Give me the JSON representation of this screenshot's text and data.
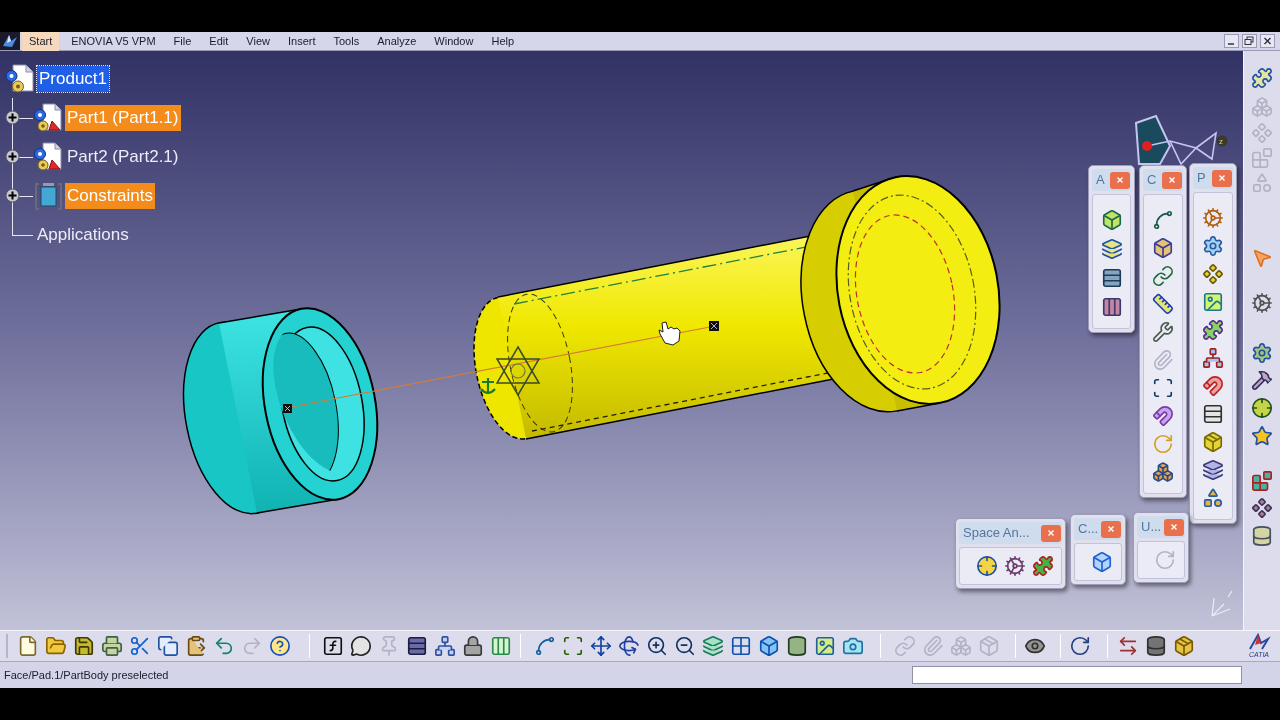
{
  "menu_bar": {
    "items": [
      {
        "label": "Start",
        "selected": true
      },
      {
        "label": "ENOVIA V5 VPM",
        "selected": false
      },
      {
        "label": "File",
        "selected": false
      },
      {
        "label": "Edit",
        "selected": false
      },
      {
        "label": "View",
        "selected": false
      },
      {
        "label": "Insert",
        "selected": false
      },
      {
        "label": "Tools",
        "selected": false
      },
      {
        "label": "Analyze",
        "selected": false
      },
      {
        "label": "Window",
        "selected": false
      },
      {
        "label": "Help",
        "selected": false
      }
    ]
  },
  "tree": [
    {
      "label": "Product1",
      "kind": "product",
      "selected": true,
      "highlighted": false,
      "expandable": false,
      "children": [
        {
          "label": "Part1 (Part1.1)",
          "kind": "part",
          "selected": false,
          "highlighted": true,
          "expandable": true
        },
        {
          "label": "Part2 (Part2.1)",
          "kind": "part",
          "selected": false,
          "highlighted": false,
          "expandable": true
        },
        {
          "label": "Constraints",
          "kind": "constraints",
          "selected": false,
          "highlighted": true,
          "expandable": true
        },
        {
          "label": "Applications",
          "kind": "label",
          "selected": false,
          "highlighted": false,
          "expandable": false
        }
      ]
    }
  ],
  "compass": {
    "axis_label": "z"
  },
  "floating_toolbars": [
    {
      "title": "A"
    },
    {
      "title": "C"
    },
    {
      "title": "P"
    },
    {
      "title": "Space An..."
    },
    {
      "title": "C..."
    },
    {
      "title": "U..."
    }
  ],
  "toolbar_logo": {
    "text": "CATIA"
  },
  "status_bar": {
    "message": "Face/Pad.1/PartBody preselected"
  }
}
